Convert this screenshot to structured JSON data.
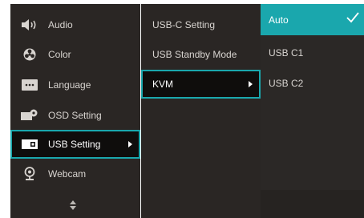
{
  "menu": {
    "items": [
      {
        "label": "Audio",
        "icon": "speaker-icon"
      },
      {
        "label": "Color",
        "icon": "color-wheel-icon"
      },
      {
        "label": "Language",
        "icon": "language-icon"
      },
      {
        "label": "OSD Setting",
        "icon": "osd-setting-icon"
      },
      {
        "label": "USB Setting",
        "icon": "usb-setting-icon",
        "selected": true
      },
      {
        "label": "Webcam",
        "icon": "webcam-icon"
      }
    ],
    "scroll_icon": "scroll-updown-icon"
  },
  "submenu": {
    "items": [
      {
        "label": "USB-C Setting"
      },
      {
        "label": "USB Standby Mode"
      },
      {
        "label": "KVM",
        "active": true
      }
    ]
  },
  "options": {
    "items": [
      {
        "label": "Auto",
        "checked": true
      },
      {
        "label": "USB C1"
      },
      {
        "label": "USB C2"
      }
    ]
  },
  "colors": {
    "accent": "#1aa7ad",
    "panel": "#2a2624",
    "text": "#d8d4d0"
  }
}
